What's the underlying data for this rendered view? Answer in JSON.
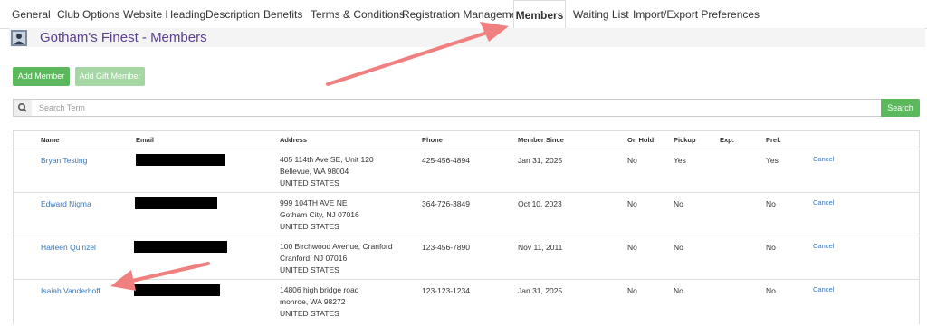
{
  "tabs": [
    {
      "label": "General"
    },
    {
      "label": "Club Options"
    },
    {
      "label": "Website Heading"
    },
    {
      "label": "Description"
    },
    {
      "label": "Benefits"
    },
    {
      "label": "Terms & Conditions"
    },
    {
      "label": "Registration Management"
    },
    {
      "label": "Members",
      "active": true
    },
    {
      "label": "Waiting List"
    },
    {
      "label": "Import/Export Preferences"
    }
  ],
  "page": {
    "title": "Gotham's Finest - Members",
    "icon": "club-icon"
  },
  "actions": {
    "add_member": "Add Member",
    "add_gift_member": "Add Gift Member"
  },
  "search": {
    "placeholder": "Search Term",
    "value": "",
    "button": "Search",
    "icon": "search-icon"
  },
  "table": {
    "headers": [
      "Name",
      "Email",
      "Address",
      "Phone",
      "Member Since",
      "On Hold",
      "Pickup",
      "Exp.",
      "Pref."
    ],
    "rows": [
      {
        "name": "Bryan Testing",
        "address": [
          "405 114th Ave SE, Unit 120",
          "Bellevue, WA 98004",
          "UNITED STATES"
        ],
        "phone": "425-456-4894",
        "member_since": "Jan 31, 2025",
        "on_hold": "No",
        "pickup": "Yes",
        "exp": "",
        "pref": "Yes",
        "action": "Cancel"
      },
      {
        "name": "Edward Nigma",
        "address": [
          "999 104TH AVE NE",
          "Gotham City, NJ 07016",
          "UNITED STATES"
        ],
        "phone": "364-726-3849",
        "member_since": "Oct 10, 2023",
        "on_hold": "No",
        "pickup": "No",
        "exp": "",
        "pref": "No",
        "action": "Cancel"
      },
      {
        "name": "Harleen Quinzel",
        "address": [
          "100 Birchwood Avenue, Cranford",
          "Cranford, NJ 07016",
          "UNITED STATES"
        ],
        "phone": "123-456-7890",
        "member_since": "Nov 11, 2011",
        "on_hold": "No",
        "pickup": "No",
        "exp": "",
        "pref": "No",
        "action": "Cancel"
      },
      {
        "name": "Isaiah Vanderhoff",
        "address": [
          "14806 high bridge road",
          "monroe, WA 98272",
          "UNITED STATES"
        ],
        "phone": "123-123-1234",
        "member_since": "Jan 31, 2025",
        "on_hold": "No",
        "pickup": "No",
        "exp": "",
        "pref": "No",
        "action": "Cancel"
      }
    ]
  },
  "colors": {
    "accent_green": "#5cb85c",
    "title_purple": "#5a3e8f",
    "link_blue": "#3a77b5",
    "annotation_arrow": "#f08080"
  }
}
